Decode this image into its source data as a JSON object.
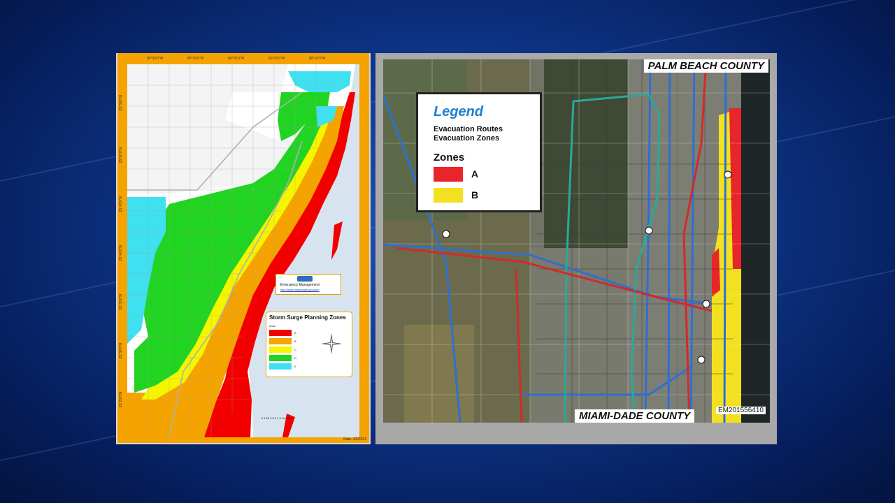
{
  "left_map": {
    "top_coords": [
      "80°30'0\"W",
      "80°25'0\"W",
      "80°20'0\"W",
      "80°15'0\"W",
      "80°10'0\"W"
    ],
    "side_coords": [
      "25°55'0\"N",
      "25°50'0\"N",
      "25°45'0\"N",
      "25°40'0\"N",
      "25°35'0\"N",
      "25°30'0\"N",
      "25°25'0\"N"
    ],
    "logo": {
      "line1": "Emergency Management",
      "line2": "http://www.miamidade.gov/oem"
    },
    "legend": {
      "title": "Storm Surge Planning Zones",
      "zone_header": "Zone",
      "zones": [
        {
          "label": "A",
          "color": "#f20000"
        },
        {
          "label": "B",
          "color": "#f5a300"
        },
        {
          "label": "C",
          "color": "#f5f500"
        },
        {
          "label": "D",
          "color": "#22d422"
        },
        {
          "label": "E",
          "color": "#3fe0f0"
        }
      ]
    },
    "scale": "0 1.25 2.5 5 7.5 10 Miles",
    "date": "Date: 4/2/2013"
  },
  "right_map": {
    "north_label": "PALM BEACH COUNTY",
    "south_label": "MIAMI-DADE COUNTY",
    "code": "EM201556410",
    "legend": {
      "title": "Legend",
      "routes": "Evacuation Routes",
      "zones_line": "Evacuation Zones",
      "zones_title": "Zones",
      "zones": [
        {
          "label": "A",
          "color": "#e8252a"
        },
        {
          "label": "B",
          "color": "#f3e11f"
        }
      ]
    }
  }
}
